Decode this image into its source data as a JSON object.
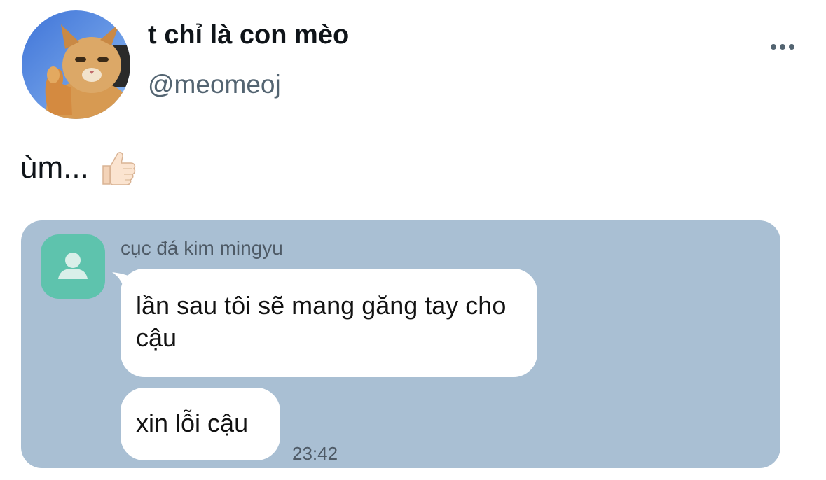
{
  "author": {
    "display_name": "t chỉ là con mèo",
    "handle": "@meomeoj"
  },
  "tweet": {
    "text": "ùm...",
    "emoji": "thumbs-up-light-skin-tone"
  },
  "screenshot": {
    "contact_name": "cục đá kim mingyu",
    "messages": [
      {
        "text": "lần sau tôi sẽ mang găng tay cho cậu"
      },
      {
        "text": "xin lỗi cậu"
      }
    ],
    "timestamp": "23:42"
  },
  "colors": {
    "chat_background": "#a9bfd3",
    "contact_avatar": "#5ec3ad",
    "handle_text": "#536471"
  },
  "icons": [
    "cat-avatar-icon",
    "more-options-icon",
    "thumbs-up-emoji-icon",
    "default-person-icon"
  ]
}
